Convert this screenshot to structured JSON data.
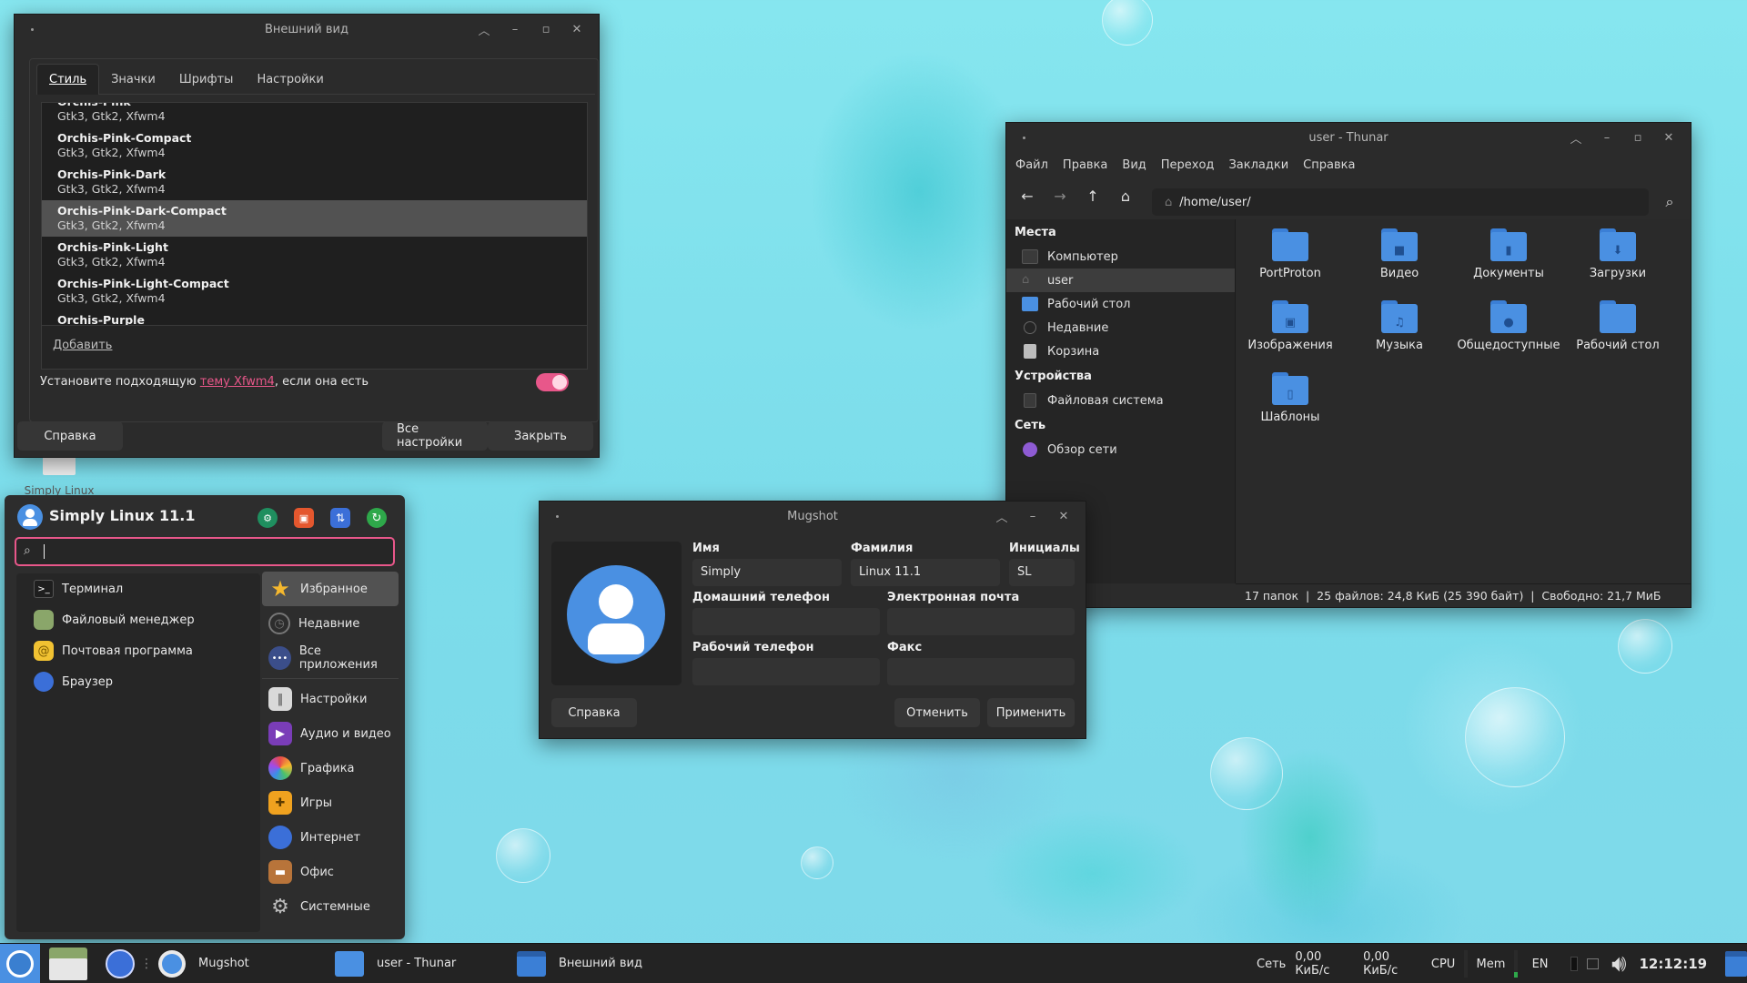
{
  "colors": {
    "accent": "#4a90e2",
    "pink": "#e8578a",
    "desktop": "#7fdcea"
  },
  "desktop_icon": {
    "label": "Simply Linux"
  },
  "appearance": {
    "title": "Внешний вид",
    "tabs": [
      "Стиль",
      "Значки",
      "Шрифты",
      "Настройки"
    ],
    "themes": [
      {
        "name": "Orchis-Pink",
        "sub": "Gtk3, Gtk2, Xfwm4"
      },
      {
        "name": "Orchis-Pink-Compact",
        "sub": "Gtk3, Gtk2, Xfwm4"
      },
      {
        "name": "Orchis-Pink-Dark",
        "sub": "Gtk3, Gtk2, Xfwm4"
      },
      {
        "name": "Orchis-Pink-Dark-Compact",
        "sub": "Gtk3, Gtk2, Xfwm4"
      },
      {
        "name": "Orchis-Pink-Light",
        "sub": "Gtk3, Gtk2, Xfwm4"
      },
      {
        "name": "Orchis-Pink-Light-Compact",
        "sub": "Gtk3, Gtk2, Xfwm4"
      },
      {
        "name": "Orchis-Purple",
        "sub": ""
      }
    ],
    "add_label": "Добавить",
    "hint_pre": "Установите подходящую ",
    "hint_link": "тему Xfwm4",
    "hint_post": ", если она есть",
    "toggle_on": true,
    "help": "Справка",
    "all_settings": "Все настройки",
    "close": "Закрыть"
  },
  "thunar": {
    "title": "user - Thunar",
    "menus": [
      "Файл",
      "Правка",
      "Вид",
      "Переход",
      "Закладки",
      "Справка"
    ],
    "path": "/home/user/",
    "places_head": "Места",
    "places": [
      "Компьютер",
      "user",
      "Рабочий стол",
      "Недавние",
      "Корзина"
    ],
    "devices_head": "Устройства",
    "devices": [
      "Файловая система"
    ],
    "network_head": "Сеть",
    "network": [
      "Обзор сети"
    ],
    "folders": [
      "PortProton",
      "Видео",
      "Документы",
      "Загрузки",
      "Изображения",
      "Музыка",
      "Общедоступные",
      "Рабочий стол",
      "Шаблоны"
    ],
    "status": "17 папок  |  25 файлов: 24,8 КиБ (25 390 байт)  |  Свободно: 21,7 МиБ"
  },
  "mugshot": {
    "title": "Mugshot",
    "first_label": "Имя",
    "first_value": "Simply",
    "last_label": "Фамилия",
    "last_value": "Linux 11.1",
    "initials_label": "Инициалы",
    "initials_value": "SL",
    "home_phone_label": "Домашний телефон",
    "home_phone_value": "",
    "email_label": "Электронная почта",
    "email_value": "",
    "work_phone_label": "Рабочий телефон",
    "work_phone_value": "",
    "fax_label": "Факс",
    "fax_value": "",
    "help": "Справка",
    "cancel": "Отменить",
    "apply": "Применить"
  },
  "menu": {
    "title": "Simply Linux 11.1",
    "search_value": "",
    "favorites": [
      "Терминал",
      "Файловый менеджер",
      "Почтовая программа",
      "Браузер"
    ],
    "categories": [
      "Избранное",
      "Недавние",
      "Все приложения",
      "Настройки",
      "Аудио и видео",
      "Графика",
      "Игры",
      "Интернет",
      "Офис",
      "Системные"
    ]
  },
  "taskbar": {
    "tasks": [
      "Mugshot",
      "user - Thunar",
      "Внешний вид"
    ],
    "net_label": "Сеть",
    "net_down": "0,00 КиБ/с",
    "net_up": "0,00 КиБ/с",
    "cpu": "CPU",
    "mem": "Mem",
    "lang": "EN",
    "clock": "12:12:19"
  }
}
